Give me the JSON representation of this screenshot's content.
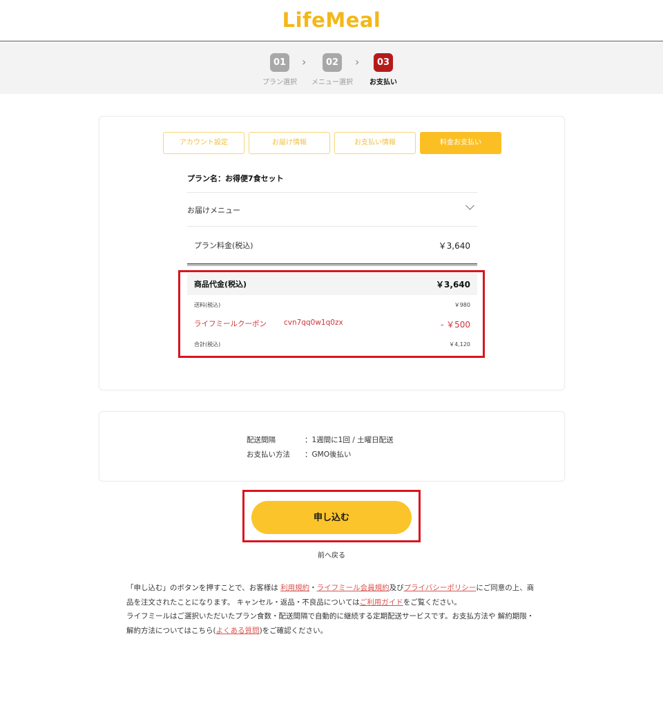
{
  "header": {
    "logo": "LifeMeal",
    "brand_color": "#f4b718"
  },
  "steps": [
    {
      "num": "01",
      "label": "プラン選択",
      "active": false
    },
    {
      "num": "02",
      "label": "メニュー選択",
      "active": false
    },
    {
      "num": "03",
      "label": "お支払い",
      "active": true
    }
  ],
  "step_separator": "›",
  "tabs": [
    {
      "label": "アカウント設定",
      "active": false
    },
    {
      "label": "お届け情報",
      "active": false
    },
    {
      "label": "お支払い情報",
      "active": false
    },
    {
      "label": "料金お支払い",
      "active": true
    }
  ],
  "plan": {
    "name": "プラン名：お得便7食セット",
    "delivery_menu": "お届けメニュー",
    "price_label": "プラン料金(税込)",
    "price_value": "￥3,640"
  },
  "summary": {
    "goods_label": "商品代金(税込)",
    "goods_value": "￥3,640",
    "shipping_label": "送料(税込)",
    "shipping_value": "￥980",
    "coupon_label": "ライフミールクーポン",
    "coupon_code": "cvn7qq0w1q0zx",
    "coupon_value": "- ￥500",
    "total_label": "合計(税込)",
    "total_value": "￥4,120"
  },
  "info": {
    "interval_label": "配送間隔",
    "interval_value": "：1週間に1回 / 土曜日配送",
    "payment_label": "お支払い方法",
    "payment_value": "：GMO後払い"
  },
  "actions": {
    "apply": "申し込む",
    "back": "前へ戻る"
  },
  "terms": {
    "p1": "「申し込む」のボタンを押すことで、お客様は ",
    "link_terms": "利用規約",
    "sep1": "・",
    "link_member": "ライフミール会員規約",
    "p2": "及び",
    "link_privacy": "プライバシーポリシー",
    "p3": "にご同意の上、商品を注文されたことになります。 キャンセル・返品・不良品については",
    "link_guide": "ご利用ガイド",
    "p4": "をご覧ください。",
    "p5": "ライフミールはご選択いただいたプラン食数・配送間隔で自動的に継続する定期配送サービスです。お支払方法や 解約期限・解約方法についてはこちら(",
    "link_faq": "よくある質問",
    "p6": ")をご確認ください。"
  },
  "colors": {
    "accent": "#fbc42b",
    "highlight": "#d9141f",
    "coupon": "#d0323a",
    "active_step": "#b41c1c"
  }
}
